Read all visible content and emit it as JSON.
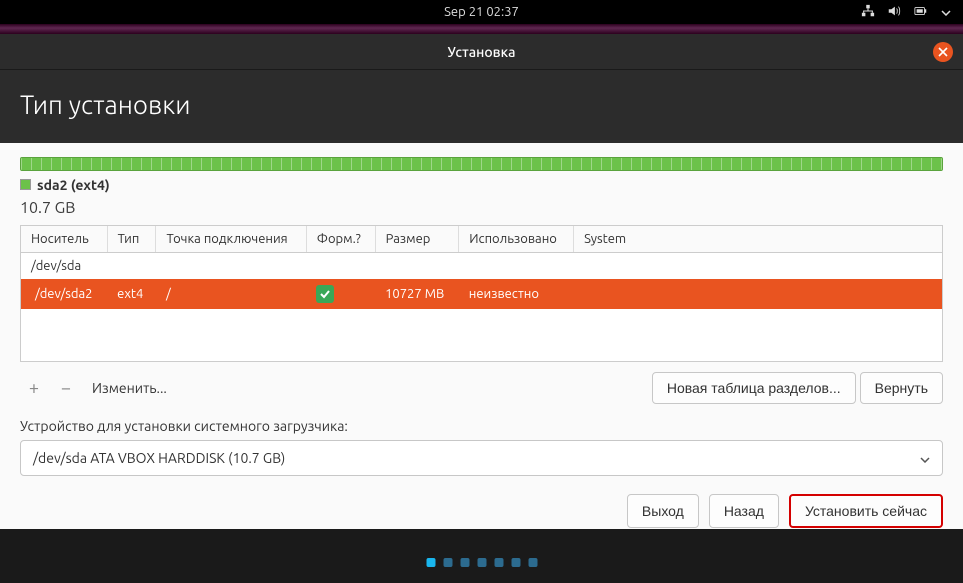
{
  "topbar": {
    "datetime": "Sep 21  02:37"
  },
  "window": {
    "title": "Установка",
    "heading": "Тип установки"
  },
  "disk_visual": {
    "partition_name": "sda2 (ext4)",
    "partition_size": "10.7 GB"
  },
  "table": {
    "headers": [
      "Носитель",
      "Тип",
      "Точка подключения",
      "Форм.?",
      "Размер",
      "Использовано",
      "System"
    ],
    "rows": [
      {
        "device": "/dev/sda",
        "type": "",
        "mount": "",
        "format": false,
        "size": "",
        "used": "",
        "system": "",
        "selected": false,
        "is_parent": true
      },
      {
        "device": "/dev/sda2",
        "type": "ext4",
        "mount": "/",
        "format": true,
        "size": "10727 MB",
        "used": "неизвестно",
        "system": "",
        "selected": true,
        "is_parent": false
      }
    ]
  },
  "toolbar": {
    "add": "+",
    "remove": "−",
    "change": "Изменить...",
    "new_table": "Новая таблица разделов...",
    "revert": "Вернуть"
  },
  "bootloader": {
    "label": "Устройство для установки системного загрузчика:",
    "value": "/dev/sda   ATA VBOX HARDDISK (10.7 GB)"
  },
  "footer": {
    "quit": "Выход",
    "back": "Назад",
    "install": "Установить сейчас"
  },
  "progress": {
    "total": 7,
    "active": 0
  }
}
